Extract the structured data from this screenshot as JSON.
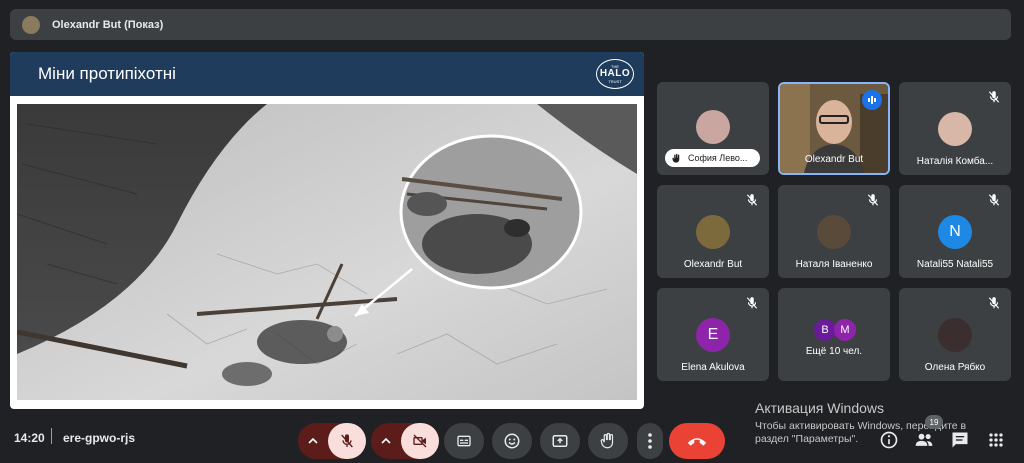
{
  "presenter_bar": {
    "title": "Olexandr But (Показ)"
  },
  "slide": {
    "title": "Міни протипіхотні",
    "logo_main": "HALO",
    "logo_sub_top": "THE",
    "logo_sub_bottom": "TRUST"
  },
  "participants": [
    {
      "name": "София Лево...",
      "hand_raised": true,
      "avatar_color": "#c9a6a0"
    },
    {
      "name": "Olexandr But",
      "speaking": true
    },
    {
      "name": "Наталія Комба...",
      "muted": true,
      "avatar_color": "#d9b7a8"
    },
    {
      "name": "Olexandr But",
      "muted": true,
      "avatar_color": "#7d6a3c"
    },
    {
      "name": "Наталя Іваненко",
      "muted": true,
      "avatar_color": "#5a4a3a"
    },
    {
      "name": "Natali55 Natali55",
      "muted": true,
      "initial": "N",
      "avatar_color": "#1e88e5"
    },
    {
      "name": "Elena Akulova",
      "muted": true,
      "initial": "E",
      "avatar_color": "#8e24aa"
    },
    {
      "name": "Ещё 10 чел.",
      "initials": [
        "B",
        "M"
      ],
      "avatar_colors": [
        "#6a1b9a",
        "#8e24aa"
      ]
    },
    {
      "name": "Олена Рябко",
      "muted": true,
      "avatar_color": "#3a2e2e"
    }
  ],
  "bottom_bar": {
    "time": "14:20",
    "meeting_code": "ere-gpwo-rjs",
    "participants_count": "19"
  },
  "windows_activation": {
    "title": "Активация Windows",
    "line1": "Чтобы активировать Windows, перейдите в",
    "line2": "раздел \"Параметры\"."
  },
  "colors": {
    "background": "#202124",
    "tile": "#3c4043",
    "speaking_border": "#8ab4f8",
    "hangup": "#ea4335",
    "muted_control": "#f9dedc",
    "slide_header": "#1f3c5c"
  },
  "icons": {
    "mic": "mic-off-icon",
    "camera": "camera-off-icon",
    "captions": "captions-icon",
    "emoji": "emoji-icon",
    "present": "present-screen-icon",
    "hand": "raise-hand-icon",
    "more": "more-options-icon",
    "hangup": "hangup-icon",
    "info": "info-icon",
    "people": "people-icon",
    "chat": "chat-icon",
    "activities": "activities-icon"
  }
}
